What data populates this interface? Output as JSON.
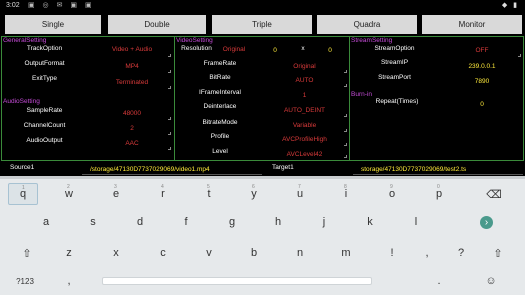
{
  "status": {
    "time": "3:02",
    "left_icons": "▣ ◎ ✉ ▣ ▣",
    "right_icons": "◆ ▮"
  },
  "modes": [
    "Single",
    "Double",
    "Triple",
    "Quadra",
    "Monitor"
  ],
  "sections": {
    "general": "GeneralSetting",
    "video": "VideoSetting",
    "stream": "StreamSetting",
    "audio": "AudioSetting",
    "burn": "Burn-in"
  },
  "general": {
    "track_option": {
      "label": "TrackOption",
      "value": "Video + Audio"
    },
    "output_format": {
      "label": "OutputFormat",
      "value": "MP4"
    },
    "exit_type": {
      "label": "ExitType",
      "value": "Terminated"
    }
  },
  "audio": {
    "sample_rate": {
      "label": "SampleRate",
      "value": "48000"
    },
    "channel_count": {
      "label": "ChannelCount",
      "value": "2"
    },
    "audio_output": {
      "label": "AudioOutput",
      "value": "AAC"
    }
  },
  "video": {
    "resolution": {
      "label": "Resolution",
      "value": "Original",
      "w": "0",
      "x": "x",
      "h": "0"
    },
    "frame_rate": {
      "label": "FrameRate",
      "value": "Original"
    },
    "bit_rate": {
      "label": "BitRate",
      "value": "AUTO"
    },
    "iframe_interval": {
      "label": "IFrameInterval",
      "value": "1"
    },
    "deinterlace": {
      "label": "Deinterlace",
      "value": "AUTO_DEINT"
    },
    "bitrate_mode": {
      "label": "BitrateMode",
      "value": "Variable"
    },
    "profile": {
      "label": "Profile",
      "value": "AVCProfileHigh"
    },
    "level": {
      "label": "Level",
      "value": "AVCLevel42"
    }
  },
  "stream": {
    "stream_option": {
      "label": "StreamOption",
      "value": "OFF"
    },
    "stream_ip": {
      "label": "StreamIP",
      "value": "239.0.0.1"
    },
    "stream_port": {
      "label": "StreamPort",
      "value": "7890"
    },
    "repeat": {
      "label": "Repeat(Times)",
      "value": "0"
    }
  },
  "source": {
    "label": "Source1",
    "path": "/storage/47130D7737029069/video1.mp4"
  },
  "target": {
    "label": "Target1",
    "path": "storage/47130D7737029069/test2.ts"
  },
  "keyboard": {
    "row1": [
      {
        "k": "q",
        "n": "1"
      },
      {
        "k": "w",
        "n": "2"
      },
      {
        "k": "e",
        "n": "3"
      },
      {
        "k": "r",
        "n": "4"
      },
      {
        "k": "t",
        "n": "5"
      },
      {
        "k": "y",
        "n": "6"
      },
      {
        "k": "u",
        "n": "7"
      },
      {
        "k": "i",
        "n": "8"
      },
      {
        "k": "o",
        "n": "9"
      },
      {
        "k": "p",
        "n": "0"
      },
      {
        "k": "⌫",
        "n": ""
      }
    ],
    "row2": [
      "a",
      "s",
      "d",
      "f",
      "g",
      "h",
      "j",
      "k",
      "l"
    ],
    "row3": [
      "⇧",
      "z",
      "x",
      "c",
      "v",
      "b",
      "n",
      "m",
      "!",
      ",",
      "?",
      "⇧"
    ],
    "row4": {
      "sym": "?123",
      "comma": ",",
      "period": ".",
      "emoji": "☺"
    },
    "go_icon": "›"
  }
}
